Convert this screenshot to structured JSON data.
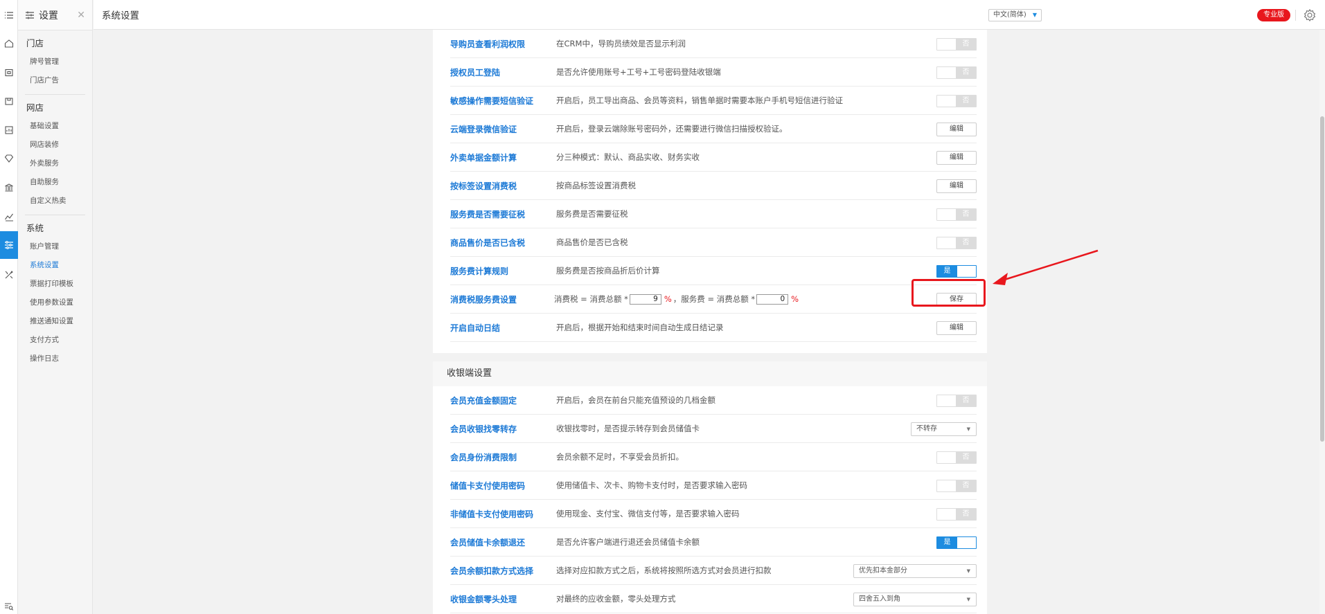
{
  "rail": {
    "icons": [
      "menu-icon",
      "home-icon",
      "store-icon",
      "shop-icon",
      "report-icon",
      "gem-icon",
      "bank-icon",
      "chart-icon",
      "settings-sliders-icon",
      "tools-icon",
      "search-list-icon"
    ]
  },
  "sidebar": {
    "title": "设置",
    "groups": [
      {
        "label": "门店",
        "items": [
          "牌号管理",
          "门店广告"
        ]
      },
      {
        "label": "网店",
        "items": [
          "基础设置",
          "网店装修",
          "外卖服务",
          "自助服务",
          "自定义热卖"
        ]
      },
      {
        "label": "系统",
        "items": [
          "账户管理",
          "系统设置",
          "票据打印模板",
          "使用参数设置",
          "推送通知设置",
          "支付方式",
          "操作日志"
        ]
      }
    ],
    "active_item": "系统设置"
  },
  "header": {
    "title": "系统设置",
    "language": "中文(简体)",
    "edition_badge": "专业版"
  },
  "toggle_labels": {
    "on": "是",
    "off": "否"
  },
  "button_labels": {
    "edit": "编辑",
    "save": "保存"
  },
  "section1": {
    "rows": [
      {
        "name": "导购员查看利润权限",
        "desc": "在CRM中，导购员绩效是否显示利润",
        "control": "toggle",
        "state": "off"
      },
      {
        "name": "授权员工登陆",
        "desc": "是否允许使用账号+工号+工号密码登陆收银端",
        "control": "toggle",
        "state": "off"
      },
      {
        "name": "敏感操作需要短信验证",
        "desc": "开启后，员工导出商品、会员等资料，销售单据时需要本账户手机号短信进行验证",
        "control": "toggle",
        "state": "off"
      },
      {
        "name": "云端登录微信验证",
        "desc": "开启后，登录云端除账号密码外，还需要进行微信扫描授权验证。",
        "control": "edit"
      },
      {
        "name": "外卖单据金额计算",
        "desc": "分三种模式：默认、商品实收、财务实收",
        "control": "edit"
      },
      {
        "name": "按标签设置消费税",
        "desc": "按商品标签设置消费税",
        "control": "edit"
      },
      {
        "name": "服务费是否需要征税",
        "desc": "服务费是否需要征税",
        "control": "toggle",
        "state": "off"
      },
      {
        "name": "商品售价是否已含税",
        "desc": "商品售价是否已含税",
        "control": "toggle",
        "state": "off"
      },
      {
        "name": "服务费计算规则",
        "desc": "服务费是否按商品折后价计算",
        "control": "toggle",
        "state": "on"
      },
      {
        "name": "消费税服务费设置",
        "control": "save"
      },
      {
        "name": "开启自动日结",
        "desc": "开启后，根据开始和结束时间自动生成日结记录",
        "control": "edit"
      }
    ],
    "tax_setting": {
      "tax_prefix": "消费税 = 消费总额 *",
      "tax_value": "9",
      "pct": "%",
      "separator": "，",
      "fee_prefix": "服务费 = 消费总额 *",
      "fee_value": "0"
    }
  },
  "section2": {
    "title": "收银端设置",
    "rows": [
      {
        "name": "会员充值金额固定",
        "desc": "开启后，会员在前台只能充值预设的几档金额",
        "control": "toggle",
        "state": "off"
      },
      {
        "name": "会员收银找零转存",
        "desc": "收银找零时，是否提示转存到会员储值卡",
        "control": "select",
        "value": "不转存"
      },
      {
        "name": "会员身份消费限制",
        "desc": "会员余额不足时，不享受会员折扣。",
        "control": "toggle",
        "state": "off"
      },
      {
        "name": "储值卡支付使用密码",
        "desc": "使用储值卡、次卡、购物卡支付时，是否要求输入密码",
        "control": "toggle",
        "state": "off"
      },
      {
        "name": "非储值卡支付使用密码",
        "desc": "使用现金、支付宝、微信支付等，是否要求输入密码",
        "control": "toggle",
        "state": "off"
      },
      {
        "name": "会员储值卡余额退还",
        "desc": "是否允许客户端进行退还会员储值卡余额",
        "control": "toggle",
        "state": "on"
      },
      {
        "name": "会员余额扣款方式选择",
        "desc": "选择对应扣款方式之后，系统将按照所选方式对会员进行扣款",
        "control": "select",
        "value": "优先扣本金部分"
      },
      {
        "name": "收银金额零头处理",
        "desc": "对最终的应收金额，零头处理方式",
        "control": "select",
        "value": "四舍五入到角"
      }
    ]
  }
}
